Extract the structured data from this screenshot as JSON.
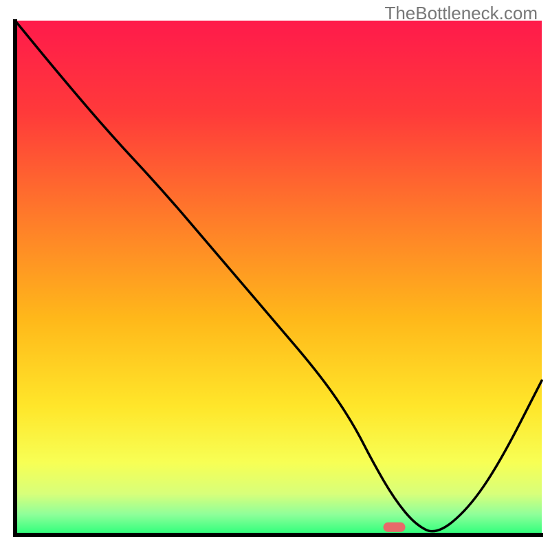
{
  "watermark": "TheBottleneck.com",
  "chart_data": {
    "type": "line",
    "title": "",
    "xlabel": "",
    "ylabel": "",
    "xlim": [
      0,
      100
    ],
    "ylim": [
      0,
      100
    ],
    "x": [
      0,
      8,
      18,
      28,
      38,
      48,
      58,
      64,
      68,
      72,
      76,
      80,
      86,
      92,
      100
    ],
    "values": [
      100,
      90,
      78,
      67,
      55,
      43,
      31,
      22,
      14,
      7,
      2,
      0,
      5,
      14,
      30
    ],
    "marker": {
      "x": 72,
      "y": 1.5,
      "color": "#e86a6a"
    },
    "gradient_stops": [
      {
        "offset": 0.0,
        "color": "#ff1a4b"
      },
      {
        "offset": 0.18,
        "color": "#ff3a3a"
      },
      {
        "offset": 0.38,
        "color": "#ff7a2a"
      },
      {
        "offset": 0.58,
        "color": "#ffb81a"
      },
      {
        "offset": 0.75,
        "color": "#ffe62a"
      },
      {
        "offset": 0.86,
        "color": "#f7ff55"
      },
      {
        "offset": 0.92,
        "color": "#d8ff7a"
      },
      {
        "offset": 0.96,
        "color": "#8fff9a"
      },
      {
        "offset": 1.0,
        "color": "#2aff7a"
      }
    ],
    "axis_color": "#000000",
    "axis_width": 6,
    "curve_color": "#000000",
    "curve_width": 3.5
  }
}
